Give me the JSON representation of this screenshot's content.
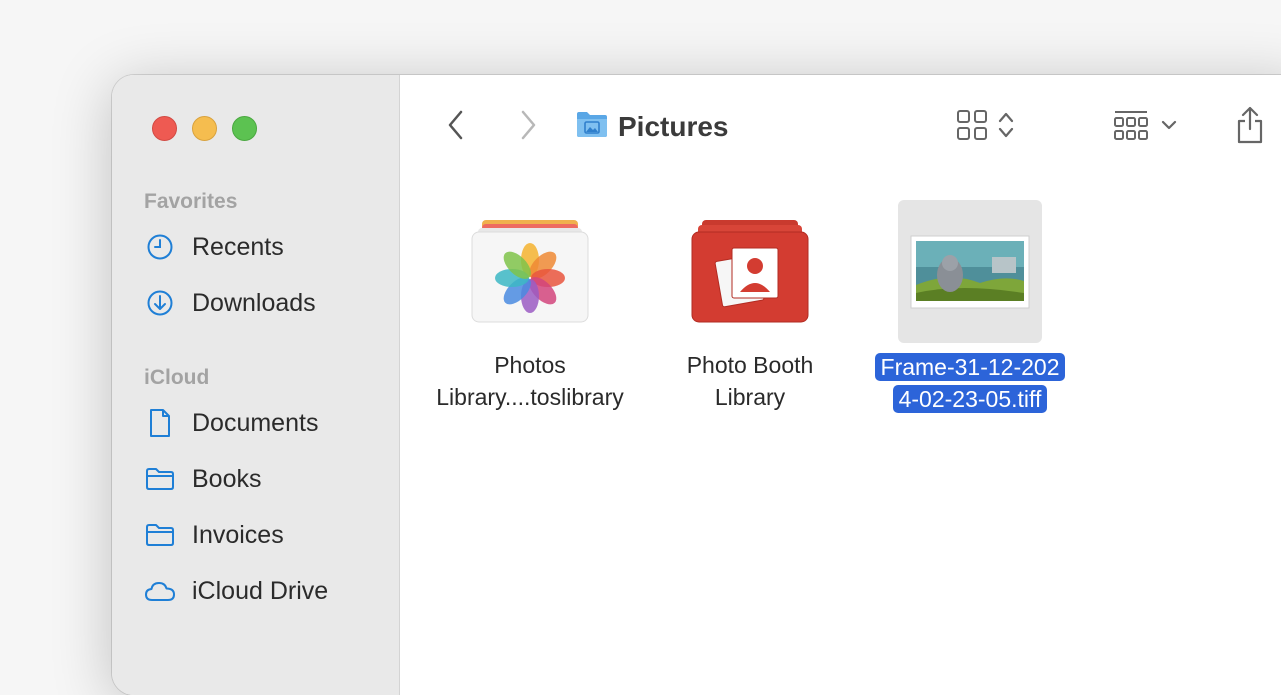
{
  "window": {
    "traffic_lights": {
      "close": "#ee5a52",
      "minimize": "#f5bd4f",
      "zoom": "#5cc251"
    }
  },
  "sidebar": {
    "sections": [
      {
        "title": "Favorites",
        "items": [
          {
            "label": "Recents",
            "icon": "clock-icon"
          },
          {
            "label": "Downloads",
            "icon": "download-circle-icon"
          }
        ]
      },
      {
        "title": "iCloud",
        "items": [
          {
            "label": "Documents",
            "icon": "document-icon"
          },
          {
            "label": "Books",
            "icon": "folder-icon"
          },
          {
            "label": "Invoices",
            "icon": "folder-icon"
          },
          {
            "label": "iCloud Drive",
            "icon": "cloud-icon"
          }
        ]
      }
    ],
    "accent": "#1f7fd6"
  },
  "toolbar": {
    "title": "Pictures",
    "title_icon": "pictures-folder-icon",
    "back_icon": "chevron-left-icon",
    "forward_icon": "chevron-right-icon",
    "view_icon": "grid-view-icon",
    "group_icon": "group-by-icon",
    "share_icon": "share-icon"
  },
  "files": [
    {
      "name_line1": "Photos",
      "name_line2": "Library....toslibrary",
      "icon": "photos-library-icon",
      "selected": false
    },
    {
      "name_line1": "Photo Booth",
      "name_line2": "Library",
      "icon": "photo-booth-library-icon",
      "selected": false
    },
    {
      "name_line1": "Frame-31-12-202",
      "name_line2": "4-02-23-05.tiff",
      "icon": "tiff-image-thumbnail",
      "selected": true
    }
  ],
  "selection_color": "#2c64d9"
}
